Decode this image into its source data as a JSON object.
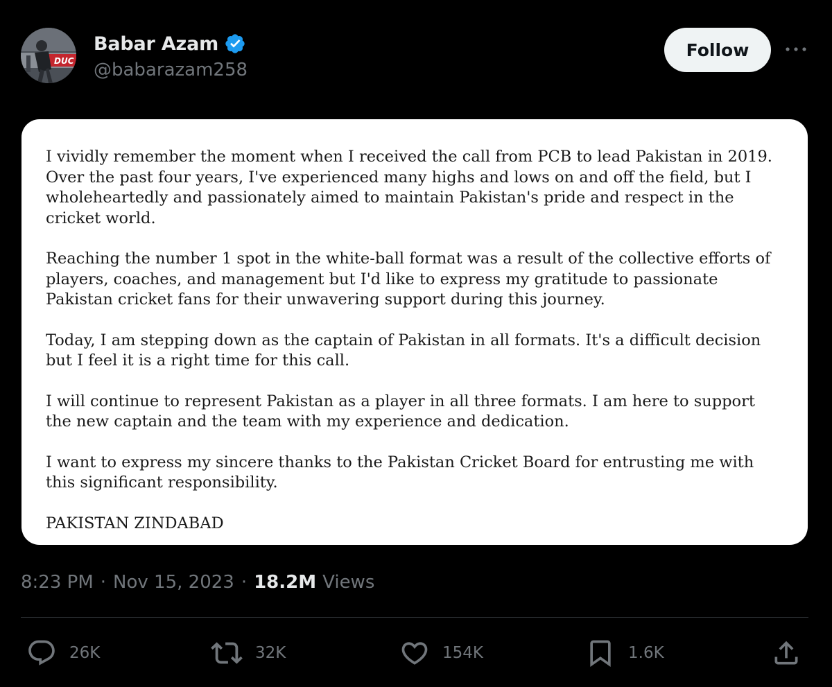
{
  "author": {
    "display_name": "Babar Azam",
    "handle": "@babarazam258",
    "verified": true,
    "avatar_banner_text": "DUC"
  },
  "follow_label": "Follow",
  "statement": {
    "paragraphs": [
      "I vividly remember the moment when I received the call from PCB to lead Pakistan in 2019. Over the past four years, I've experienced many highs and lows on and off the field, but I wholeheartedly and passionately aimed to maintain Pakistan's pride and respect in the cricket world.",
      "Reaching the number 1 spot in the white-ball format was a result of the collective efforts of players, coaches, and management but I'd like to express my gratitude to passionate Pakistan cricket fans for their unwavering support during this journey.",
      "Today, I am stepping down as the captain of Pakistan in all formats. It's a difficult decision but I feel it is a right time for this call.",
      "I will continue to represent Pakistan as a player in all three formats. I am here to support the new captain and the team with my experience and dedication.",
      "I want to express my sincere thanks to the Pakistan Cricket Board for entrusting me with this significant responsibility.",
      "PAKISTAN ZINDABAD"
    ]
  },
  "meta": {
    "time": "8:23 PM",
    "separator": "·",
    "date": "Nov 15, 2023",
    "views_count": "18.2M",
    "views_label": "Views"
  },
  "actions": {
    "replies": "26K",
    "reposts": "32K",
    "likes": "154K",
    "bookmarks": "1.6K"
  },
  "colors": {
    "background": "#000000",
    "text_primary": "#e7e9ea",
    "text_secondary": "#71767b",
    "verified_blue": "#1d9bf0",
    "follow_bg": "#eff3f4",
    "card_bg": "#ffffff",
    "divider": "#2f3336"
  },
  "icons": {
    "verified": "verified-badge-icon",
    "more": "more-dots-icon",
    "reply": "reply-bubble-icon",
    "repost": "repost-arrows-icon",
    "like": "heart-icon",
    "bookmark": "bookmark-icon",
    "share": "share-upload-icon"
  }
}
